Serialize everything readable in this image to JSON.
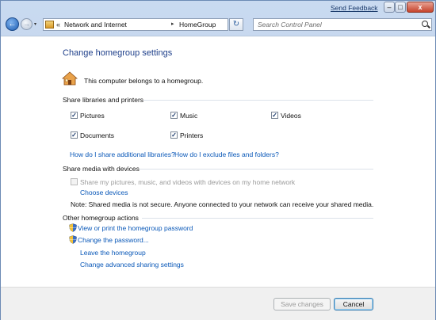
{
  "titlebar": {
    "send_feedback": "Send Feedback",
    "minimize": "–",
    "maximize": "□",
    "close": "x"
  },
  "nav": {
    "back": "←",
    "forward": "→",
    "history": "▾",
    "breadcrumb": [
      "Network and Internet",
      "HomeGroup"
    ],
    "breadcrumb_separator": "▸",
    "address_prefix": "«",
    "refresh": "↻",
    "search_placeholder": "Search Control Panel"
  },
  "page": {
    "title": "Change homegroup settings",
    "membership_text": "This computer belongs to a homegroup."
  },
  "share_libraries": {
    "heading": "Share libraries and printers",
    "items": [
      {
        "label": "Pictures",
        "checked": true
      },
      {
        "label": "Music",
        "checked": true
      },
      {
        "label": "Videos",
        "checked": true
      },
      {
        "label": "Documents",
        "checked": true
      },
      {
        "label": "Printers",
        "checked": true
      }
    ],
    "link_additional": "How do I share additional libraries?",
    "link_exclude": "How do I exclude files and folders?"
  },
  "share_media": {
    "heading": "Share media with devices",
    "checkbox_label": "Share my pictures, music, and videos with devices on my home network",
    "checked": false,
    "choose_devices": "Choose devices",
    "note": "Note: Shared media is not secure. Anyone connected to your network can receive your shared media."
  },
  "other_actions": {
    "heading": "Other homegroup actions",
    "view_password": "View or print the homegroup password",
    "change_password": "Change the password...",
    "leave": "Leave the homegroup",
    "advanced": "Change advanced sharing settings"
  },
  "footer": {
    "save": "Save changes",
    "cancel": "Cancel"
  },
  "colors": {
    "link": "#0a58b8",
    "title": "#1e3f8a",
    "frame": "#b9cce8"
  }
}
